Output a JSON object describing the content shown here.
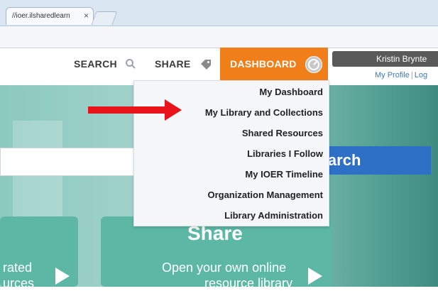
{
  "browser": {
    "tab_title": "//ioer.ilsharedlearn",
    "close_glyph": "×"
  },
  "nav": {
    "search_label": "SEARCH",
    "share_label": "SHARE",
    "dashboard_label": "DASHBOARD"
  },
  "user": {
    "name": "Kristin Brynte",
    "links": [
      "My Profile",
      "Log"
    ]
  },
  "dropdown": {
    "items": [
      "My Dashboard",
      "My Library and Collections",
      "Shared Resources",
      "Libraries I Follow",
      "My IOER Timeline",
      "Organization Management",
      "Library Administration"
    ]
  },
  "hero": {
    "search_button": "Search",
    "left_card_text_1": "rated",
    "left_card_text_2": "urces",
    "share_card_title": "Share",
    "share_card_text_1": "Open your own online",
    "share_card_text_2": "resource library"
  },
  "icons": {
    "search": "search-icon",
    "share": "tag-icon",
    "dashboard": "dashboard-gauge-icon",
    "annotation": "red-arrow-pointer"
  },
  "colors": {
    "accent": "#f07f1a",
    "search_button": "#2f70c7",
    "arrow": "#e8141a",
    "teal": "#5cb8a5"
  }
}
